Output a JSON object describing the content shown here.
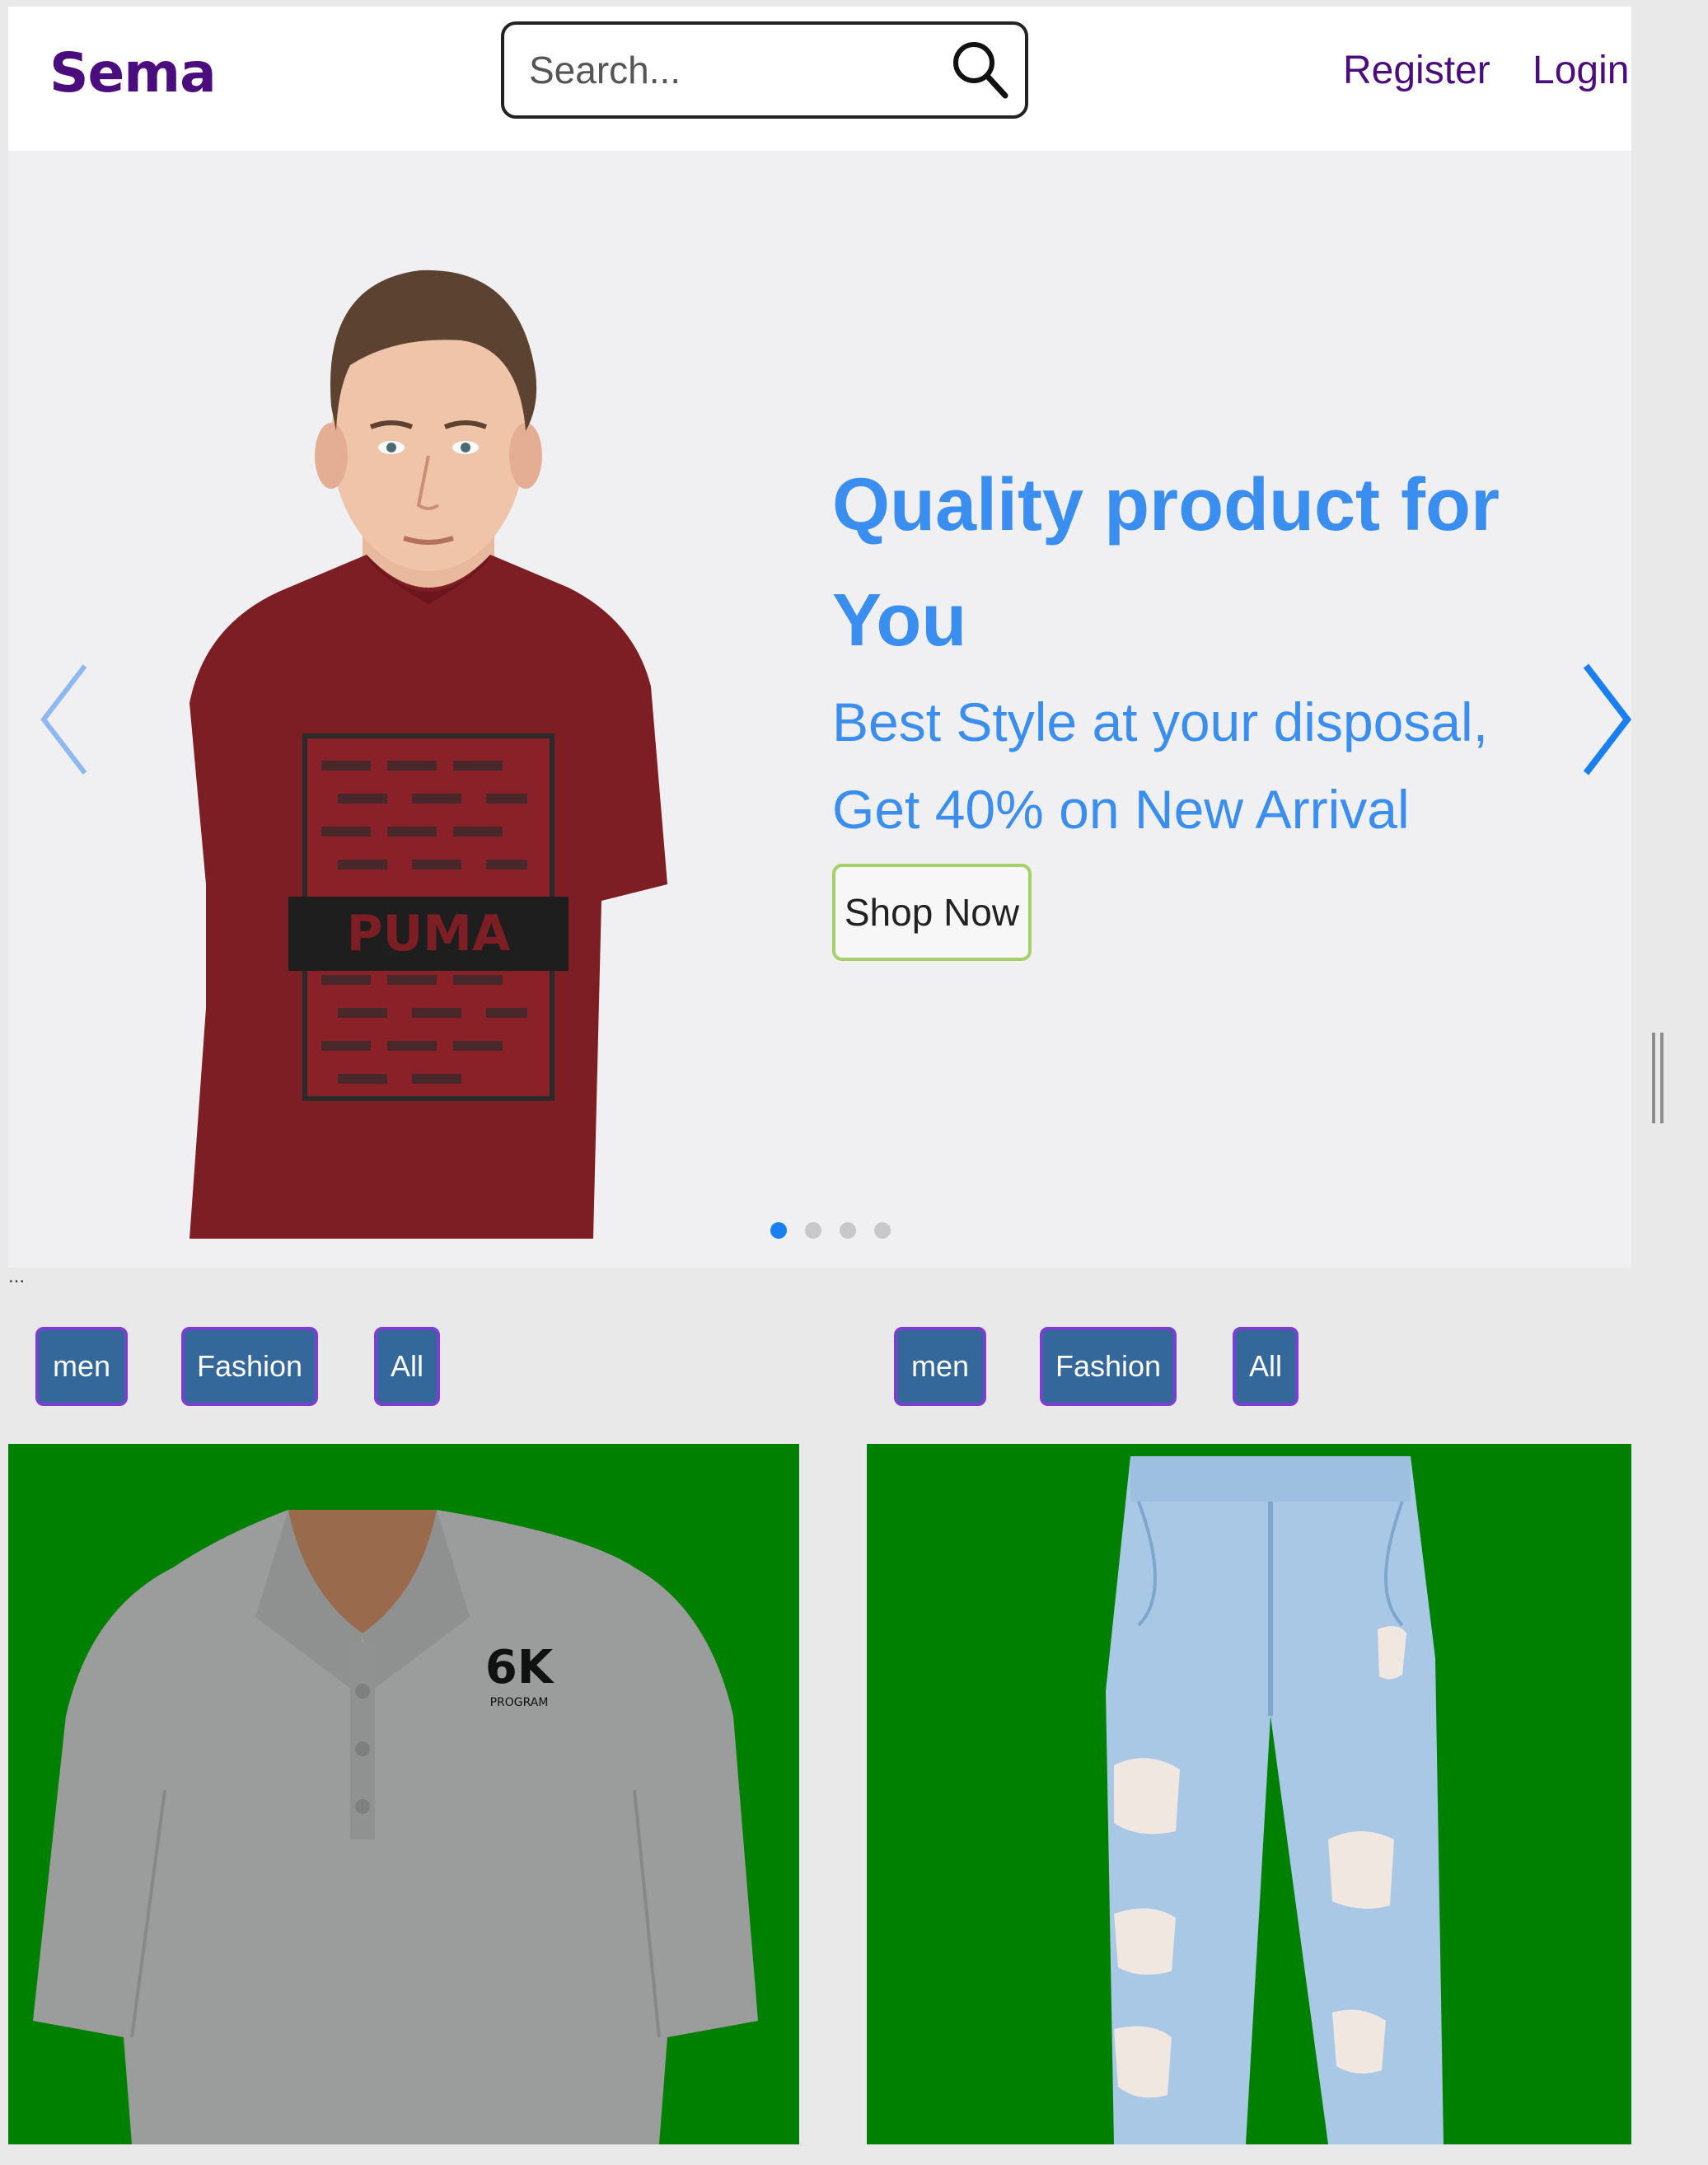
{
  "header": {
    "brand": "Sema",
    "search_placeholder": "Search...",
    "register_label": "Register",
    "login_label": "Login"
  },
  "hero": {
    "title": "Quality product for You",
    "subtitle": "Best Style at your disposal, Get 40% on New Arrival",
    "cta_label": "Shop Now",
    "shirt_print_text": "PUMA",
    "slide_count": 4,
    "active_slide": 1
  },
  "ellipsis": "...",
  "category_groups": [
    {
      "tags": [
        "men",
        "Fashion",
        "All"
      ]
    },
    {
      "tags": [
        "men",
        "Fashion",
        "All"
      ]
    }
  ],
  "products": [
    {
      "image": "grey-polo-shirt",
      "logo_text": "6K",
      "logo_sub": "PROGRAM",
      "background": "#008000"
    },
    {
      "image": "ripped-light-blue-jeans",
      "background": "#008000"
    }
  ],
  "colors": {
    "brand": "#4b0d7e",
    "accent_blue": "#3a8ef0",
    "tag_bg": "#34679a",
    "tag_border": "#7a3fd0",
    "card_bg": "#008000",
    "shop_border": "#a6d06a"
  },
  "icons": {
    "search": "search-icon",
    "prev": "chevron-left-icon",
    "next": "chevron-right-icon"
  }
}
